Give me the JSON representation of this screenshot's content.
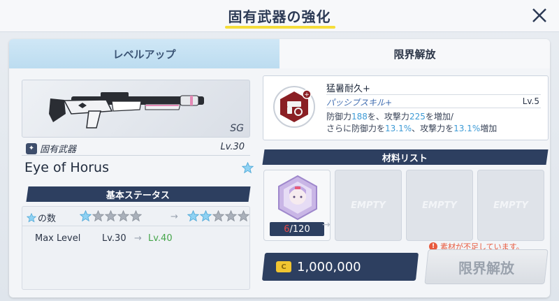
{
  "header": {
    "title": "固有武器の強化"
  },
  "tabs": [
    {
      "label": "レベルアップ"
    },
    {
      "label": "限界解放"
    }
  ],
  "weapon": {
    "type": "SG",
    "kind": "固有武器",
    "level": "Lv.30",
    "name": "Eye of Horus"
  },
  "basic_status": {
    "heading": "基本ステータス",
    "stars_label": "の数",
    "stars_current": 1,
    "stars_next": 2,
    "stars_total": 5,
    "max_level_label": "Max Level",
    "max_level_from": "Lv.30",
    "max_level_to": "Lv.40",
    "arrow": "→"
  },
  "skill": {
    "name": "猛暑耐久+",
    "type": "パッシブスキル+",
    "level": "Lv.5",
    "desc_line1_a": "防御力",
    "desc_line1_n1": "188",
    "desc_line1_b": "を、攻撃力",
    "desc_line1_n2": "225",
    "desc_line1_c": "を増加/",
    "desc_line2_a": "さらに防御力を",
    "desc_line2_n1": "13.1%",
    "desc_line2_b": "、攻撃力を",
    "desc_line2_n2": "13.1%",
    "desc_line2_c": "増加"
  },
  "materials": {
    "heading": "材料リスト",
    "owned": "6",
    "required": "/120",
    "empty_label": "EMPTY"
  },
  "cost": {
    "amount": "1,000,000"
  },
  "warning": "素材が不足しています。",
  "action": {
    "label": "限界解放"
  },
  "colors": {
    "accent_navy": "#2d3f60",
    "highlight_blue": "#3e9bd6",
    "level_green": "#45a54a",
    "warning_red": "#e85a3e",
    "title_underline": "#f5dd3a"
  }
}
